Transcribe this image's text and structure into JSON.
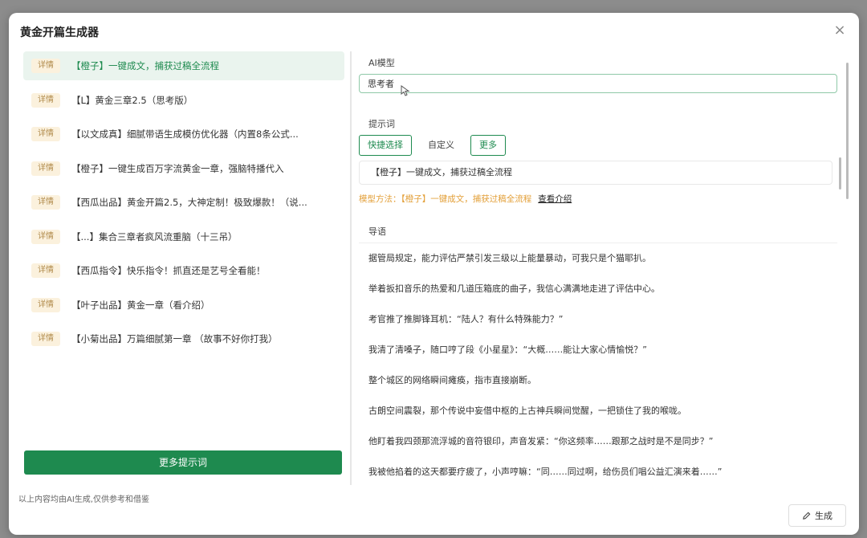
{
  "modal": {
    "title": "黄金开篇生成器",
    "close_label": "×"
  },
  "prompts": [
    {
      "tag": "详情",
      "text": "【橙子】一键成文，捕获过稿全流程",
      "active": true
    },
    {
      "tag": "详情",
      "text": "【L】黄金三章2.5（思考版）",
      "active": false
    },
    {
      "tag": "详情",
      "text": "【以文成真】细腻带语生成模仿优化器（内置8条公式...",
      "active": false
    },
    {
      "tag": "详情",
      "text": "【橙子】一键生成百万字流黄金一章，强脑特播代入",
      "active": false
    },
    {
      "tag": "详情",
      "text": "【西瓜出品】黄金开篇2.5，大神定制！极致爆款！（说...",
      "active": false
    },
    {
      "tag": "详情",
      "text": "【...】集合三章者疯风流重脑（十三吊）",
      "active": false
    },
    {
      "tag": "详情",
      "text": "【西瓜指令】快乐指令！抓直还是艺号全看能！",
      "active": false
    },
    {
      "tag": "详情",
      "text": "【叶子出品】黄金一章（看介绍）",
      "active": false
    },
    {
      "tag": "详情",
      "text": "【小菊出品】万篇细腻第一章 （故事不好你打我）",
      "active": false
    }
  ],
  "left": {
    "more_button": "更多提示词",
    "disclaimer": "以上内容均由AI生成,仅供参考和借鉴"
  },
  "right": {
    "model_label": "AI模型",
    "model_value": "思考者",
    "prompt_label": "提示词",
    "tabs": [
      {
        "label": "快捷选择",
        "style": "outlined"
      },
      {
        "label": "自定义",
        "style": "plain"
      },
      {
        "label": "更多",
        "style": "outlined"
      }
    ],
    "selected_template": "【橙子】一键成文，捕获过稿全流程",
    "hint_prefix": "模型方法：【橙子】一键成文，捕获过稿全流程",
    "hint_link": "查看介绍",
    "guide_label": "导语",
    "guide_lines": [
      "据管局规定，能力评估严禁引发三级以上能量暴动，可我只是个猫耶扒。",
      "举着扳扣音乐的热爱和几道压箱底的曲子，我信心满满地走进了评估中心。",
      "考官推了推脚锋耳机：“陆人？有什么特殊能力？”",
      "我清了清嗓子，随口哼了段《小星星》：“大概……能让大家心情愉悦？”",
      "整个城区的网络瞬间瘫痪，指市直接崩断。",
      "古朗空间震裂，那个传说中妄借中枢的上古神兵瞬间觉醒，一把锁住了我的喉咙。",
      "他盯着我四颈那流浮城的音符银印，声音发紧：“你这频率……跟那之战时是不是同步？”",
      "我被他掐着的这天都要疗疲了，小声哼嘛：“同……同过啊，给伤员们唱公益汇演来着……”"
    ],
    "generate_button": "生成"
  },
  "colors": {
    "accent": "#1e8a4f",
    "badge_bg": "#fbf1dd",
    "hint": "#e3a03a"
  }
}
